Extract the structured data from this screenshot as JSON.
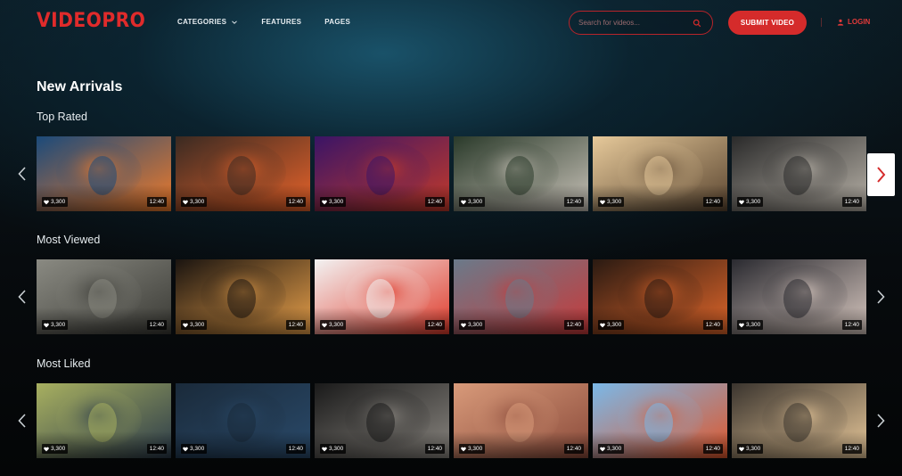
{
  "header": {
    "logo": "VIDEOPRO",
    "nav": [
      {
        "label": "CATEGORIES",
        "has_dropdown": true
      },
      {
        "label": "FEATURES",
        "has_dropdown": false
      },
      {
        "label": "PAGES",
        "has_dropdown": false
      }
    ],
    "search_placeholder": "Search for videos...",
    "submit_label": "SUBMIT VIDEO",
    "login_label": "LOGIN",
    "accent_color": "#d52b2b"
  },
  "page_title": "New Arrivals",
  "sections": [
    {
      "title": "Top Rated",
      "videos": [
        {
          "likes": "3,300",
          "duration": "12:40",
          "palette": [
            "#1b4a7a",
            "#f07b2a"
          ],
          "subject": "animated-rock-band"
        },
        {
          "likes": "3,300",
          "duration": "12:40",
          "palette": [
            "#3a2a22",
            "#e8632a"
          ],
          "subject": "long-haired-man-fire"
        },
        {
          "likes": "3,300",
          "duration": "12:40",
          "palette": [
            "#3a1466",
            "#c43a2a"
          ],
          "subject": "concert-singer"
        },
        {
          "likes": "3,300",
          "duration": "12:40",
          "palette": [
            "#2a3a2a",
            "#c8c2b8"
          ],
          "subject": "boy-in-crowd"
        },
        {
          "likes": "3,300",
          "duration": "12:40",
          "palette": [
            "#e6c99a",
            "#5a4530"
          ],
          "subject": "kids-in-sea"
        },
        {
          "likes": "3,300",
          "duration": "12:40",
          "palette": [
            "#2a2a2a",
            "#b8b2a8"
          ],
          "subject": "press-conference"
        }
      ]
    },
    {
      "title": "Most Viewed",
      "videos": [
        {
          "likes": "3,300",
          "duration": "12:40",
          "palette": [
            "#8a8a82",
            "#3a3a35"
          ],
          "subject": "skateboarder"
        },
        {
          "likes": "3,300",
          "duration": "12:40",
          "palette": [
            "#1a1410",
            "#e8a04a"
          ],
          "subject": "girl-with-lights"
        },
        {
          "likes": "3,300",
          "duration": "12:40",
          "palette": [
            "#f2f2f2",
            "#e03a2a"
          ],
          "subject": "clown-face"
        },
        {
          "likes": "3,300",
          "duration": "12:40",
          "palette": [
            "#6a7a8a",
            "#c83a3a"
          ],
          "subject": "cyclists"
        },
        {
          "likes": "3,300",
          "duration": "12:40",
          "palette": [
            "#2a1a12",
            "#e0662a"
          ],
          "subject": "firefighter"
        },
        {
          "likes": "3,300",
          "duration": "12:40",
          "palette": [
            "#2a2a30",
            "#d8c8c0"
          ],
          "subject": "woman-with-makeup"
        }
      ]
    },
    {
      "title": "Most Liked",
      "videos": [
        {
          "likes": "3,300",
          "duration": "12:40",
          "palette": [
            "#a8b060",
            "#2a3a4a"
          ],
          "subject": "boy-in-car"
        },
        {
          "likes": "3,300",
          "duration": "12:40",
          "palette": [
            "#1a2a3a",
            "#2a4a6a"
          ],
          "subject": "stormy-sea"
        },
        {
          "likes": "3,300",
          "duration": "12:40",
          "palette": [
            "#1a1a1a",
            "#8a8680"
          ],
          "subject": "hand-out-car-window"
        },
        {
          "likes": "3,300",
          "duration": "12:40",
          "palette": [
            "#d89a7a",
            "#8a4a3a"
          ],
          "subject": "desert-cliffs"
        },
        {
          "likes": "3,300",
          "duration": "12:40",
          "palette": [
            "#7ab8e8",
            "#e0562a"
          ],
          "subject": "orange-flowers"
        },
        {
          "likes": "3,300",
          "duration": "12:40",
          "palette": [
            "#3a342e",
            "#e8c89a"
          ],
          "subject": "woman-with-lights"
        }
      ]
    }
  ]
}
